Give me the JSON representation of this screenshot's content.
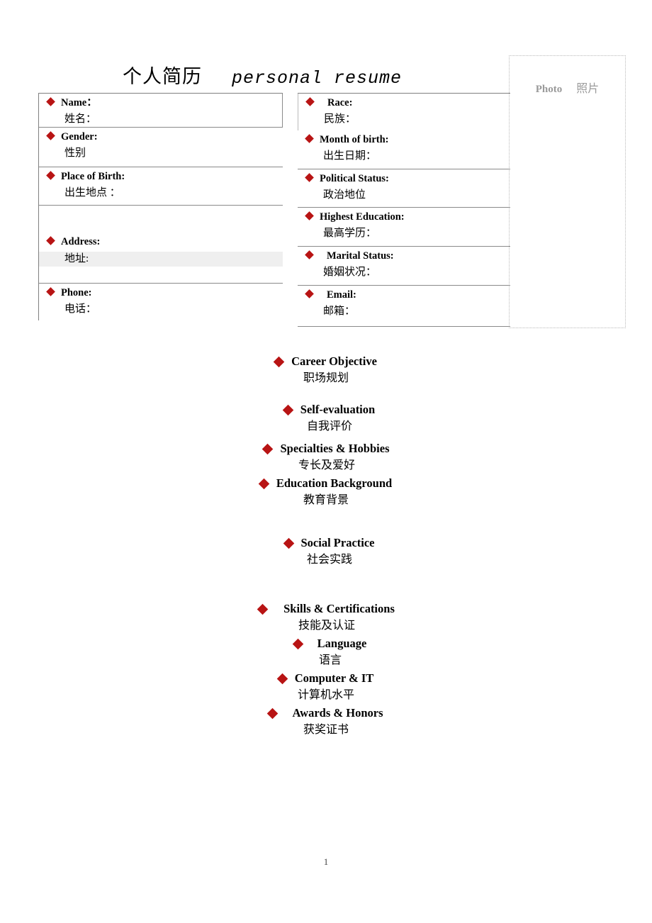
{
  "document": {
    "title_cn": "个人简历",
    "title_en": "personal resume",
    "page_number": "1"
  },
  "photo": {
    "label_en": "Photo",
    "label_cn": "照片"
  },
  "info_left": [
    {
      "en": "Name：",
      "cn": "姓名："
    },
    {
      "en": "Gender:",
      "cn": "性别"
    },
    {
      "en": "Place of Birth:",
      "cn": "出生地点 ："
    },
    {
      "en": "Address:",
      "cn": "地址:"
    },
    {
      "en": "Phone:",
      "cn": "电话："
    }
  ],
  "info_right": [
    {
      "en": "Race:",
      "cn": "民族："
    },
    {
      "en": "Month of birth:",
      "cn": "出生日期："
    },
    {
      "en": "Political Status:",
      "cn": "政治地位"
    },
    {
      "en": "Highest Education:",
      "cn": "最高学历："
    },
    {
      "en": "Marital Status:",
      "cn": "婚姻状况："
    },
    {
      "en": "Email:",
      "cn": "邮箱："
    }
  ],
  "sections": [
    {
      "en": "Career Objective",
      "cn": "职场规划"
    },
    {
      "en": "Self-evaluation",
      "cn": "自我评价"
    },
    {
      "en": "Specialties & Hobbies",
      "cn": "专长及爱好"
    },
    {
      "en": "Education Background",
      "cn": "教育背景"
    },
    {
      "en": "Social Practice",
      "cn": "社会实践"
    },
    {
      "en": "Skills & Certifications",
      "cn": "技能及认证"
    },
    {
      "en": "Language",
      "cn": "语言"
    },
    {
      "en": "Computer & IT",
      "cn": "计算机水平"
    },
    {
      "en": "Awards & Honors",
      "cn": "获奖证书"
    }
  ],
  "colors": {
    "bullet_red": "#b81414",
    "rule_gray": "#8a8a8a",
    "photo_border": "#b9b9b9",
    "photo_text": "#9a9a9a",
    "address_shade": "#efefef"
  }
}
